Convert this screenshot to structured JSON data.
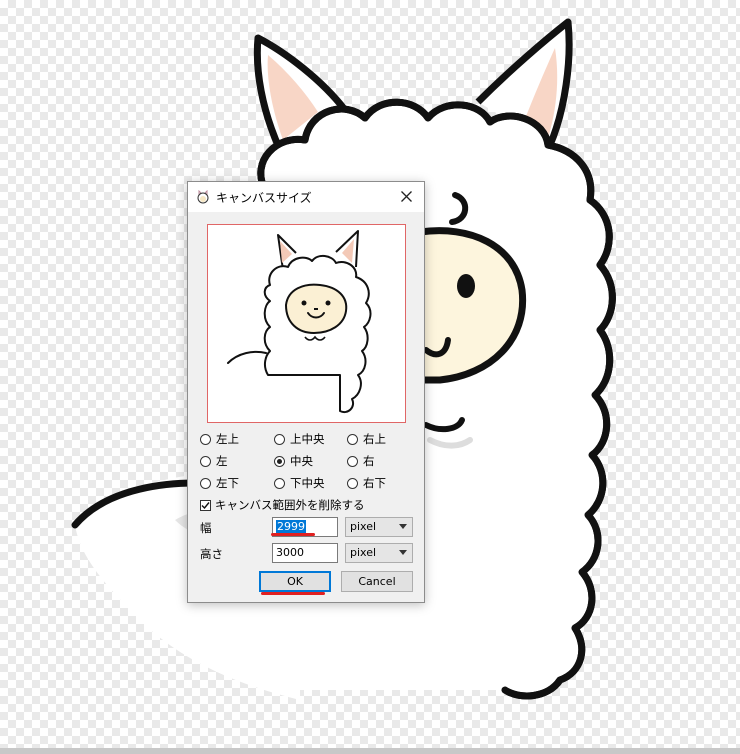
{
  "dialog": {
    "title": "キャンバスサイズ",
    "anchors": [
      {
        "label": "左上",
        "checked": false
      },
      {
        "label": "上中央",
        "checked": false
      },
      {
        "label": "右上",
        "checked": false
      },
      {
        "label": "左",
        "checked": false
      },
      {
        "label": "中央",
        "checked": true
      },
      {
        "label": "右",
        "checked": false
      },
      {
        "label": "左下",
        "checked": false
      },
      {
        "label": "下中央",
        "checked": false
      },
      {
        "label": "右下",
        "checked": false
      }
    ],
    "delete_outside_label": "キャンバス範囲外を削除する",
    "delete_outside_checked": true,
    "width_label": "幅",
    "width_value": "2999",
    "width_unit": "pixel",
    "height_label": "高さ",
    "height_value": "3000",
    "height_unit": "pixel",
    "ok_label": "OK",
    "cancel_label": "Cancel"
  },
  "colors": {
    "annotation_red": "#e02020",
    "selection_blue": "#0078d7",
    "preview_border": "#e06666"
  },
  "icons": {
    "title": "alpaca-app-icon",
    "close": "close-icon",
    "dropdown": "chevron-down-icon"
  }
}
